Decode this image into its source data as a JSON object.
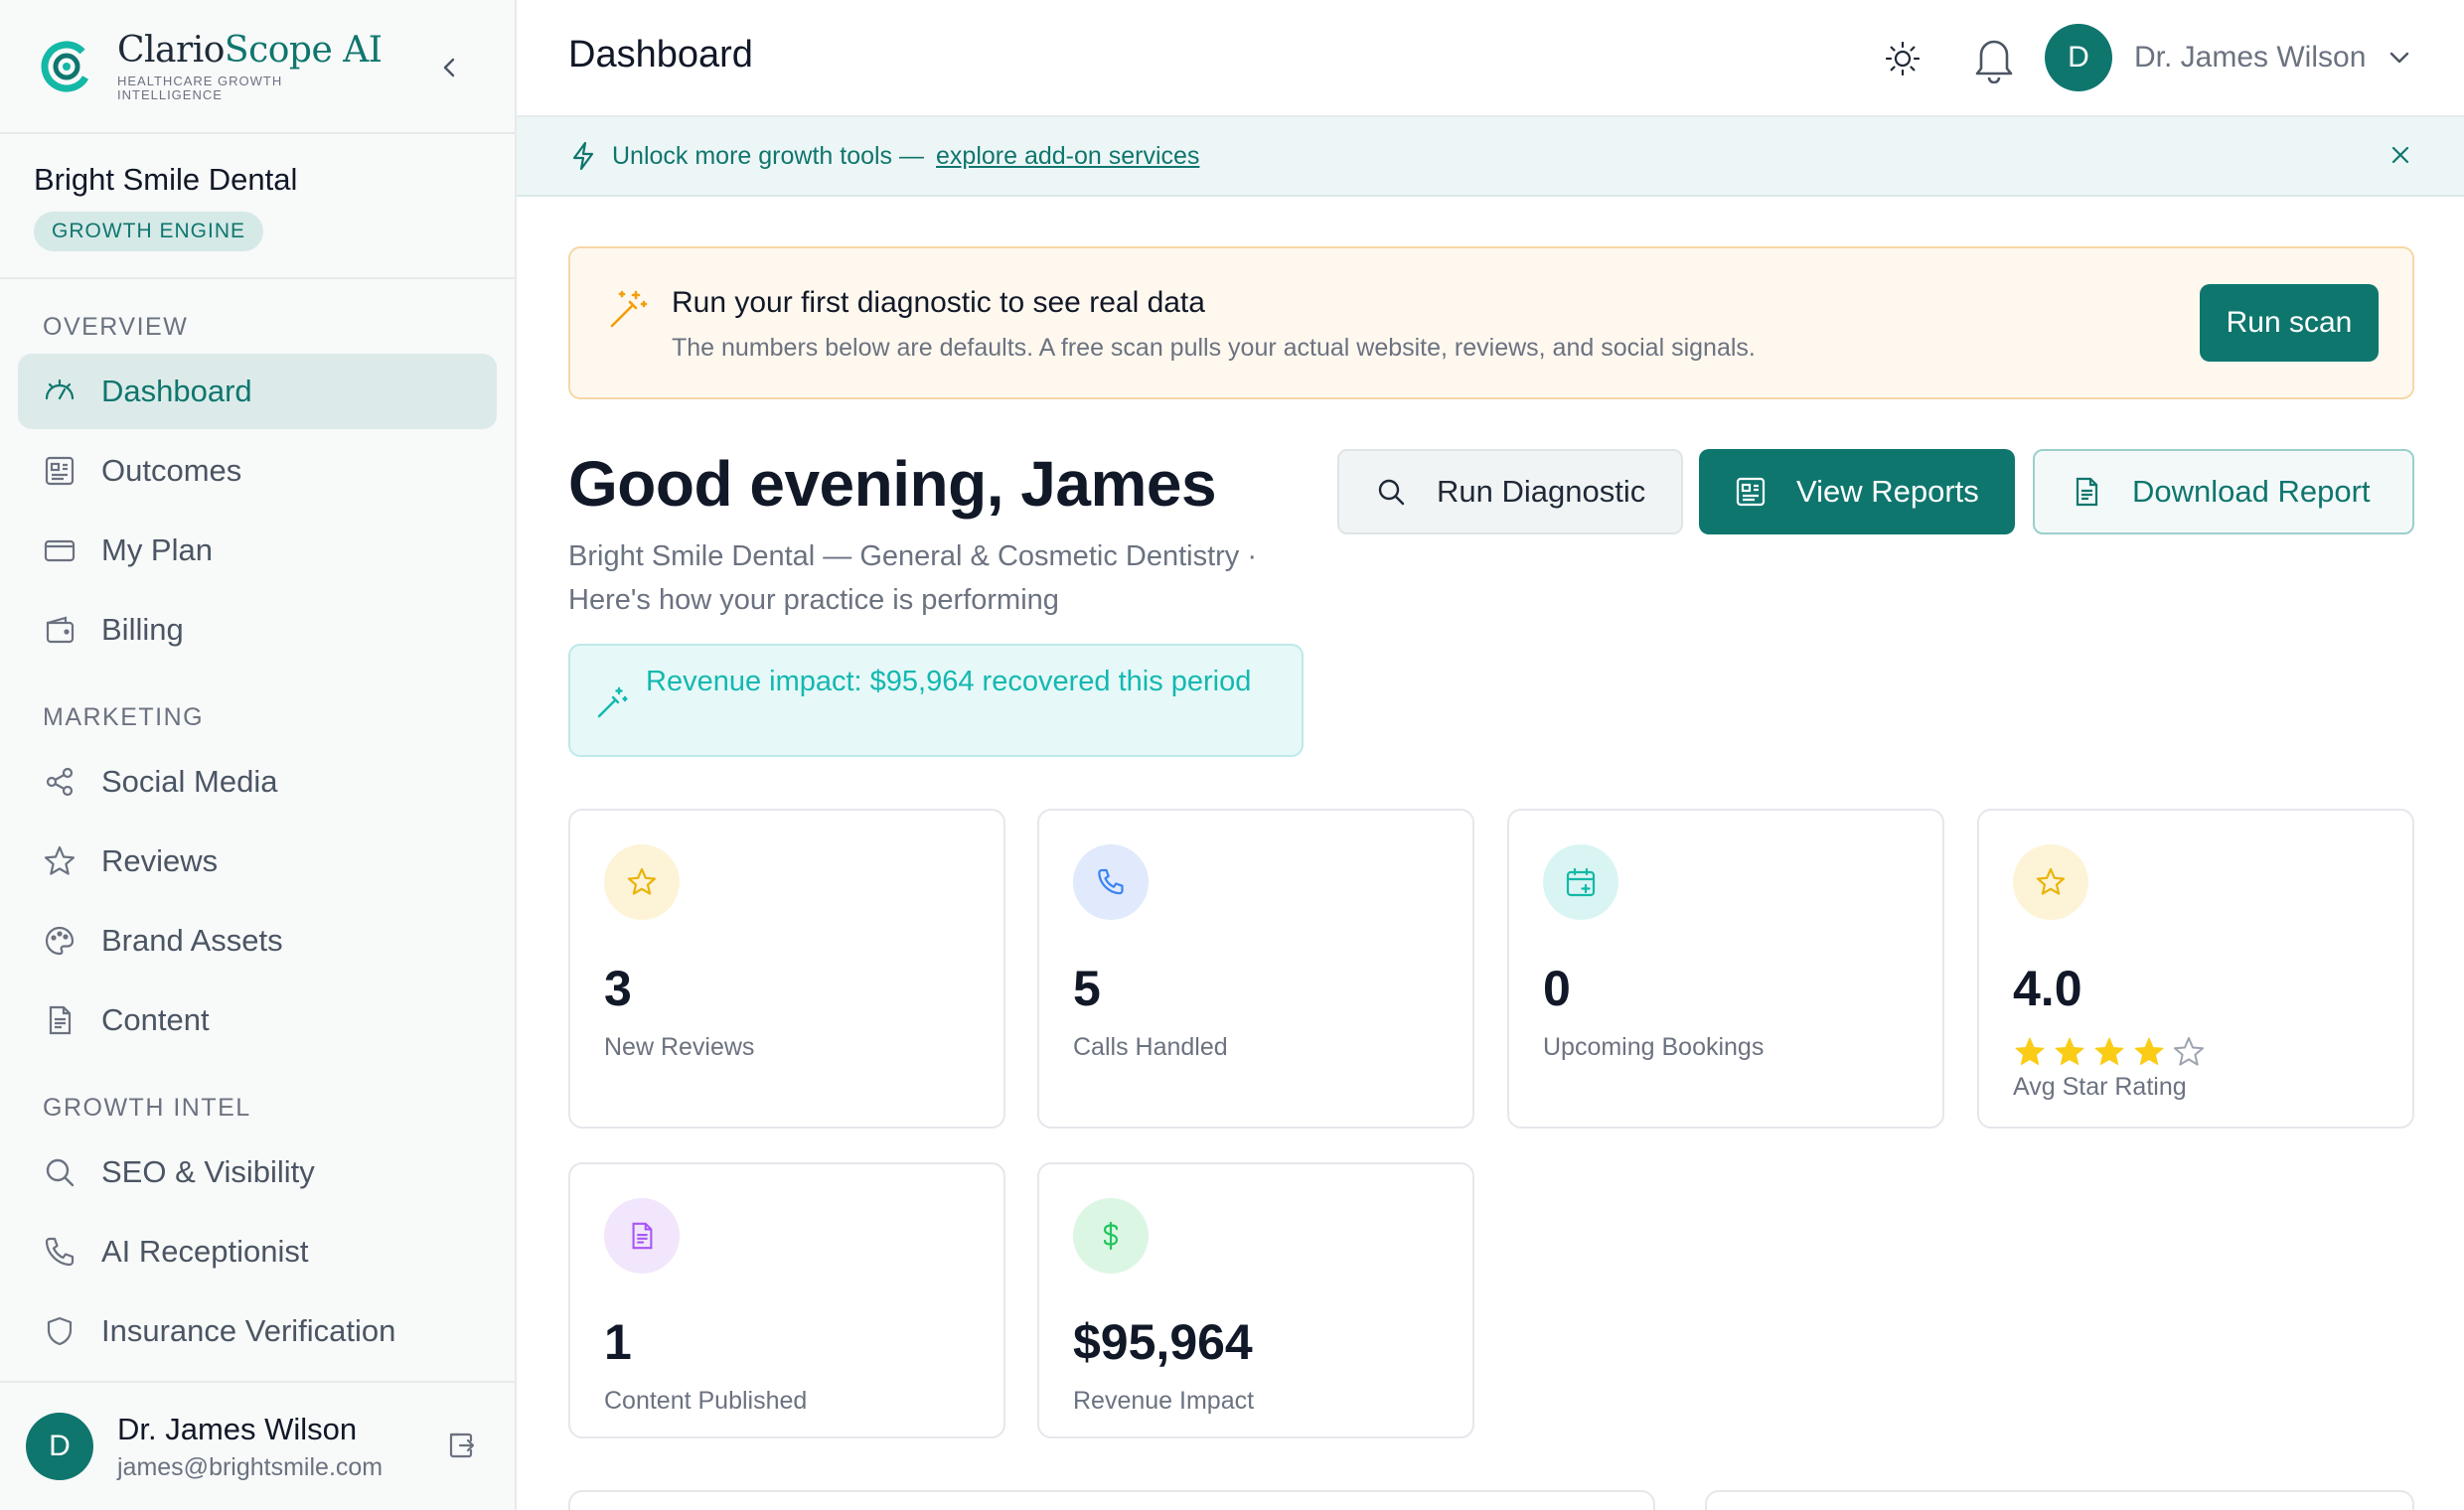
{
  "brand": {
    "name_part1": "Clario",
    "name_part2": "Scope AI",
    "tagline": "HEALTHCARE GROWTH INTELLIGENCE",
    "color": "#0f766e"
  },
  "practice": {
    "name": "Bright Smile Dental",
    "badge": "GROWTH ENGINE"
  },
  "sidebar": {
    "sections": [
      {
        "title": "OVERVIEW",
        "items": [
          {
            "label": "Dashboard",
            "icon": "dashboard-icon",
            "active": true
          },
          {
            "label": "Outcomes",
            "icon": "outcomes-icon"
          },
          {
            "label": "My Plan",
            "icon": "card-icon"
          },
          {
            "label": "Billing",
            "icon": "wallet-icon"
          }
        ]
      },
      {
        "title": "MARKETING",
        "items": [
          {
            "label": "Social Media",
            "icon": "share-icon"
          },
          {
            "label": "Reviews",
            "icon": "star-icon"
          },
          {
            "label": "Brand Assets",
            "icon": "palette-icon"
          },
          {
            "label": "Content",
            "icon": "document-icon"
          }
        ]
      },
      {
        "title": "GROWTH INTEL",
        "items": [
          {
            "label": "SEO & Visibility",
            "icon": "search-icon"
          },
          {
            "label": "AI Receptionist",
            "icon": "phone-icon"
          },
          {
            "label": "Insurance Verification",
            "icon": "shield-icon"
          }
        ]
      }
    ]
  },
  "user": {
    "name": "Dr. James Wilson",
    "email": "james@brightsmile.com",
    "initial": "D"
  },
  "topbar": {
    "title": "Dashboard"
  },
  "banner": {
    "text": "Unlock more growth tools —",
    "link": "explore add-on services"
  },
  "callout": {
    "title": "Run your first diagnostic to see real data",
    "subtitle": "The numbers below are defaults. A free scan pulls your actual website, reviews, and social signals.",
    "button": "Run scan"
  },
  "greeting": {
    "title": "Good evening, James",
    "subtitle": "Bright Smile Dental — General & Cosmetic Dentistry · Here's how your practice is performing",
    "revenue_note": "Revenue impact: $95,964 recovered this period"
  },
  "actions": {
    "diagnostic": "Run Diagnostic",
    "reports": "View Reports",
    "download": "Download Report"
  },
  "stats": [
    {
      "value": "3",
      "label": "New Reviews",
      "icon": "star-icon",
      "icon_color": "#eab308",
      "icon_bg": "#fdf3d7"
    },
    {
      "value": "5",
      "label": "Calls Handled",
      "icon": "phone-icon",
      "icon_color": "#3b82f6",
      "icon_bg": "#e0eafc"
    },
    {
      "value": "0",
      "label": "Upcoming Bookings",
      "icon": "calendar-plus-icon",
      "icon_color": "#14b8a6",
      "icon_bg": "#d9f5f3"
    },
    {
      "value": "4.0",
      "label": "Avg Star Rating",
      "icon": "star-icon",
      "icon_color": "#eab308",
      "icon_bg": "#fdf3d7",
      "stars_filled": 4,
      "stars_total": 5
    },
    {
      "value": "1",
      "label": "Content Published",
      "icon": "document-icon",
      "icon_color": "#a855f7",
      "icon_bg": "#f1e6fb"
    },
    {
      "value": "$95,964",
      "label": "Revenue Impact",
      "icon": "dollar-icon",
      "icon_color": "#22c55e",
      "icon_bg": "#dcf6e4"
    }
  ]
}
